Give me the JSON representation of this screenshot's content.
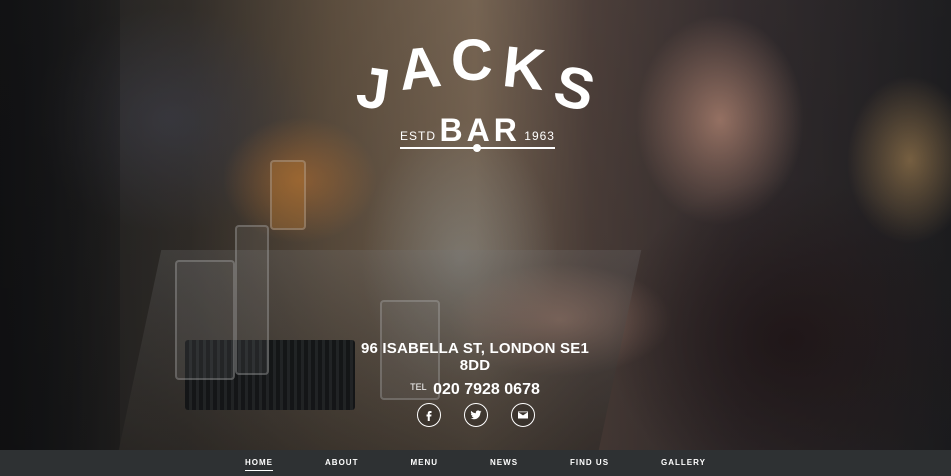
{
  "logo": {
    "letters": [
      "J",
      "A",
      "C",
      "K",
      "S"
    ],
    "estd": "ESTD",
    "bar": "BAR",
    "year": "1963"
  },
  "contact": {
    "address": "96 ISABELLA ST, LONDON SE1 8DD",
    "tel_prefix": "TEL",
    "phone": "020 7928 0678"
  },
  "social": [
    {
      "icon": "facebook-icon"
    },
    {
      "icon": "twitter-icon"
    },
    {
      "icon": "email-icon"
    }
  ],
  "nav": {
    "items": [
      "HOME",
      "ABOUT",
      "MENU",
      "NEWS",
      "FIND US",
      "GALLERY"
    ],
    "active": "HOME"
  },
  "colors": {
    "nav_bg": "#2e3133",
    "text": "#ffffff"
  }
}
